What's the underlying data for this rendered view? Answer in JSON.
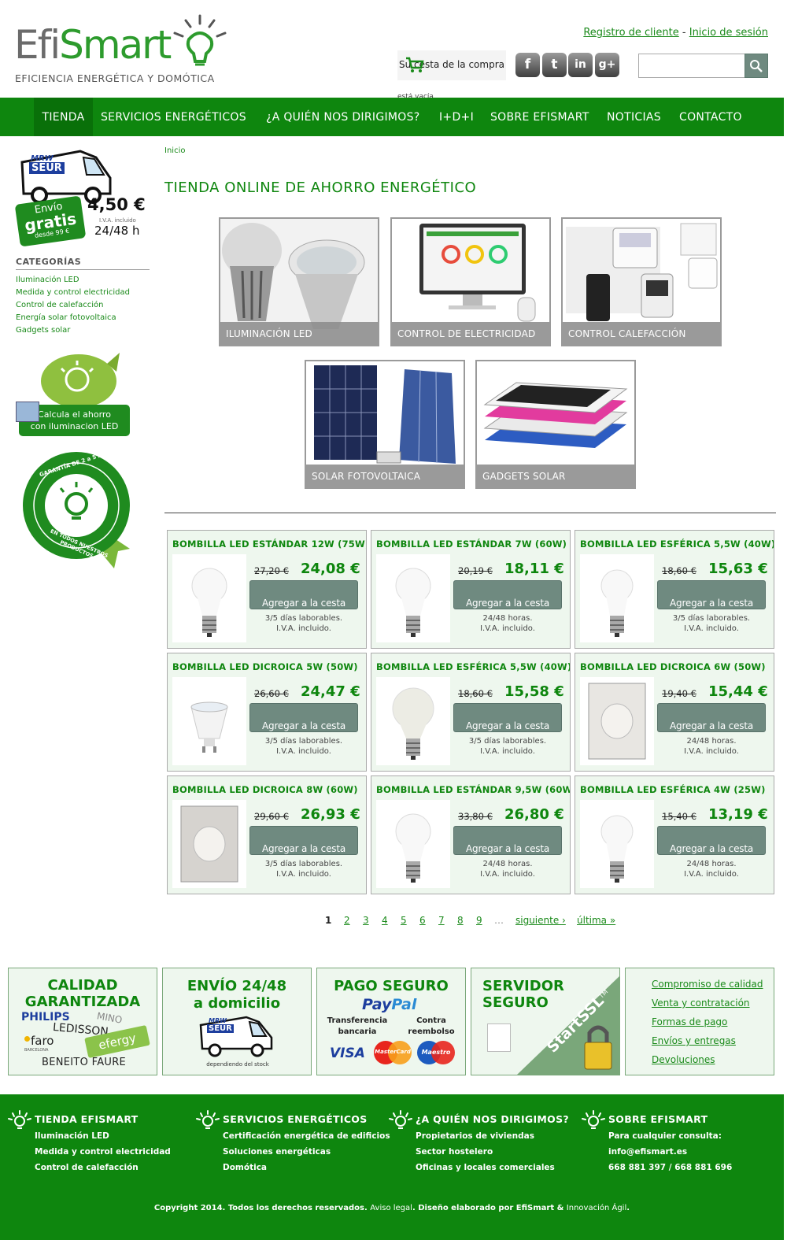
{
  "header": {
    "logo_part1": "Efi",
    "logo_part2": "Smart",
    "tagline": "EFICIENCIA ENERGÉTICA Y DOMÓTICA",
    "register_link": "Registro de cliente",
    "separator": "-",
    "login_link": "Inicio de sesión",
    "cart_label": "Su cesta de la compra",
    "cart_status": "está vacía",
    "social": [
      {
        "label": "f",
        "icon": "facebook-icon"
      },
      {
        "label": "t",
        "icon": "twitter-icon"
      },
      {
        "label": "in",
        "icon": "linkedin-icon"
      },
      {
        "label": "g+",
        "icon": "googleplus-icon"
      }
    ],
    "search_placeholder": ""
  },
  "nav": [
    {
      "label": "TIENDA",
      "active": true
    },
    {
      "label": "SERVICIOS ENERGÉTICOS"
    },
    {
      "label": "¿A QUIÉN NOS DIRIGIMOS?"
    },
    {
      "label": "I+D+I"
    },
    {
      "label": "SOBRE EFISMART"
    },
    {
      "label": "NOTICIAS"
    },
    {
      "label": "CONTACTO"
    }
  ],
  "sidebar": {
    "shipping": {
      "van_brand1": "MRW",
      "van_brand2": "SEUR",
      "envio": "Envío",
      "gratis": "gratis",
      "desde": "desde 99 €",
      "price": "4,50 €",
      "iva": "I.V.A. incluido",
      "time": "24/48 h"
    },
    "categories_title": "CATEGORÍAS",
    "categories": [
      "Iluminación LED",
      "Medida y control electricidad",
      "Control de calefacción",
      "Energía solar fotovoltaica",
      "Gadgets solar"
    ],
    "calc_banner": [
      "Calcula el ahorro",
      "con iluminacion LED"
    ],
    "guarantee_top": "GARANTÍA DE 2 a 5 AÑOS",
    "guarantee_bottom": "EN TODOS NUESTROS PRODUCTOS"
  },
  "main": {
    "breadcrumb": "Inicio",
    "title": "TIENDA ONLINE DE AHORRO ENERGÉTICO",
    "tiles": [
      "ILUMINACIÓN LED",
      "CONTROL DE ELECTRICIDAD",
      "CONTROL CALEFACCIÓN",
      "SOLAR FOTOVOLTAICA",
      "GADGETS SOLAR"
    ],
    "products": [
      {
        "name": "BOMBILLA LED ESTÁNDAR 12W (75W)",
        "old": "27,20 €",
        "price": "24,08 €",
        "button": "Agregar a la cesta",
        "delivery": "3/5 días laborables.",
        "iva": "I.V.A. incluido."
      },
      {
        "name": "BOMBILLA LED ESTÁNDAR 7W (60W)",
        "old": "20,19 €",
        "price": "18,11 €",
        "button": "Agregar a la cesta",
        "delivery": "24/48 horas.",
        "iva": "I.V.A. incluido."
      },
      {
        "name": "BOMBILLA LED ESFÉRICA 5,5W (40W)",
        "old": "18,60 €",
        "price": "15,63 €",
        "button": "Agregar a la cesta",
        "delivery": "3/5 días laborables.",
        "iva": "I.V.A. incluido."
      },
      {
        "name": "BOMBILLA LED DICROICA 5W (50W)",
        "old": "26,60 €",
        "price": "24,47 €",
        "button": "Agregar a la cesta",
        "delivery": "3/5 días laborables.",
        "iva": "I.V.A. incluido."
      },
      {
        "name": "BOMBILLA LED ESFÉRICA 5,5W (40W)",
        "old": "18,60 €",
        "price": "15,58 €",
        "button": "Agregar a la cesta",
        "delivery": "3/5 días laborables.",
        "iva": "I.V.A. incluido."
      },
      {
        "name": "BOMBILLA LED DICROICA 6W (50W)",
        "old": "19,40 €",
        "price": "15,44 €",
        "button": "Agregar a la cesta",
        "delivery": "24/48 horas.",
        "iva": "I.V.A. incluido."
      },
      {
        "name": "BOMBILLA LED DICROICA 8W (60W)",
        "old": "29,60 €",
        "price": "26,93 €",
        "button": "Agregar a la cesta",
        "delivery": "3/5 días laborables.",
        "iva": "I.V.A. incluido."
      },
      {
        "name": "BOMBILLA LED ESTÁNDAR 9,5W (60W)",
        "old": "33,80 €",
        "price": "26,80 €",
        "button": "Agregar a la cesta",
        "delivery": "24/48 horas.",
        "iva": "I.V.A. incluido."
      },
      {
        "name": "BOMBILLA LED ESFÉRICA 4W (25W)",
        "old": "15,40 €",
        "price": "13,19 €",
        "button": "Agregar a la cesta",
        "delivery": "24/48 horas.",
        "iva": "I.V.A. incluido."
      }
    ],
    "pagination": {
      "current": "1",
      "pages": [
        "2",
        "3",
        "4",
        "5",
        "6",
        "7",
        "8",
        "9"
      ],
      "ellipsis": "…",
      "next": "siguiente ›",
      "last": "última »"
    }
  },
  "footer_boxes": {
    "quality": {
      "line1": "CALIDAD",
      "line2": "GARANTIZADA",
      "brands": [
        "PHILIPS",
        "MINO",
        "LEDISSON",
        "faro",
        "BARCELONA",
        "efergy",
        "BENEITO FAURE"
      ]
    },
    "shipping": {
      "line1": "ENVÍO 24/48",
      "line2": "a domicilio",
      "van_brand1": "MRW",
      "van_brand2": "SEUR",
      "note": "dependiendo del stock"
    },
    "payment": {
      "title": "PAGO SEGURO",
      "paypal1": "Pay",
      "paypal2": "Pal",
      "transfer": [
        "Transferencia",
        "bancaria"
      ],
      "cod": [
        "Contra",
        "reembolso"
      ],
      "cards": [
        "VISA",
        "MasterCard",
        "Maestro"
      ]
    },
    "server": {
      "line1": "SERVIDOR",
      "line2": "SEGURO",
      "ssl": "StartSSL",
      "tm": "TM"
    },
    "links": [
      "Compromiso de calidad",
      "Venta y contratación",
      "Formas de pago",
      "Envíos y entregas",
      "Devoluciones"
    ]
  },
  "site_footer": {
    "columns": [
      {
        "title": "TIENDA EFISMART",
        "items": [
          "Iluminación LED",
          "Medida y control electricidad",
          "Control de calefacción"
        ]
      },
      {
        "title": "SERVICIOS ENERGÉTICOS",
        "items": [
          "Certificación energética de edificios",
          "Soluciones energéticas",
          "Domótica"
        ]
      },
      {
        "title": "¿A QUIÉN NOS DIRIGIMOS?",
        "items": [
          "Propietarios de viviendas",
          "Sector hostelero",
          "Oficinas y locales comerciales"
        ]
      },
      {
        "title": "SOBRE EFISMART",
        "items": [
          "Para cualquier consulta:",
          "info@efismart.es",
          "668 881 397 / 668 881 696"
        ]
      }
    ],
    "copyright_a": "Copyright 2014. Todos los derechos reservados.",
    "legal": "Aviso legal",
    "copyright_b": ". Diseño elaborado por EfiSmart &",
    "agile": "Innovación Ágil",
    "end": "."
  },
  "colors": {
    "brand_green": "#0e860e",
    "nav_active": "#097009",
    "button_gray": "#6f8a80"
  }
}
